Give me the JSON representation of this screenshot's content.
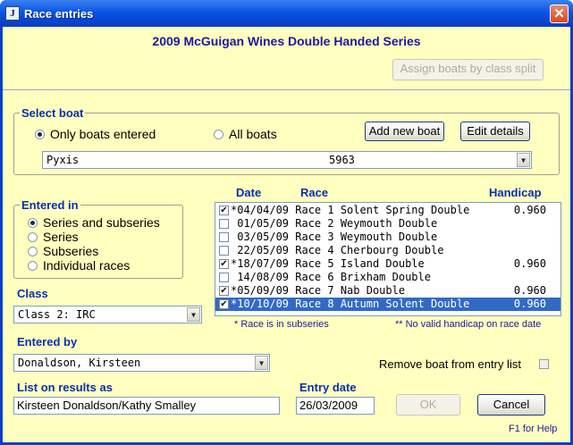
{
  "window": {
    "title": "Race entries",
    "close_glyph": "✕",
    "app_icon_glyph": "J"
  },
  "header": {
    "series_title": "2009 McGuigan Wines Double Handed Series",
    "assign_button": "Assign boats by class split"
  },
  "select_boat": {
    "title": "Select boat",
    "radio_only": "Only boats entered",
    "radio_all": "All boats",
    "selected_radio": "only",
    "add_button": "Add new boat",
    "edit_button": "Edit details",
    "boat_name": "Pyxis",
    "sail_number": "5963"
  },
  "entered_in": {
    "title": "Entered in",
    "options": [
      "Series and subseries",
      "Series",
      "Subseries",
      "Individual races"
    ],
    "selected": 0
  },
  "class": {
    "label": "Class",
    "value": "Class 2: IRC"
  },
  "entered_by": {
    "label": "Entered by",
    "value": "Donaldson, Kirsteen"
  },
  "list_on_results": {
    "label": "List on results as",
    "value": "Kirsteen Donaldson/Kathy Smalley"
  },
  "entry_date": {
    "label": "Entry date",
    "value": "26/03/2009"
  },
  "races": {
    "col_date": "Date",
    "col_race": "Race",
    "col_handicap": "Handicap",
    "rows": [
      {
        "checked": true,
        "text": "*04/04/09 Race 1 Solent Spring Double",
        "handicap": "0.960",
        "selected": false
      },
      {
        "checked": false,
        "text": " 01/05/09 Race 2 Weymouth Double",
        "handicap": "",
        "selected": false
      },
      {
        "checked": false,
        "text": " 03/05/09 Race 3 Weymouth Double",
        "handicap": "",
        "selected": false
      },
      {
        "checked": false,
        "text": " 22/05/09 Race 4 Cherbourg Double",
        "handicap": "",
        "selected": false
      },
      {
        "checked": true,
        "text": "*18/07/09 Race 5 Island Double",
        "handicap": "0.960",
        "selected": false
      },
      {
        "checked": false,
        "text": " 14/08/09 Race 6 Brixham Double",
        "handicap": "",
        "selected": false
      },
      {
        "checked": true,
        "text": "*05/09/09 Race 7 Nab Double",
        "handicap": "0.960",
        "selected": false
      },
      {
        "checked": true,
        "text": "*10/10/09 Race 8 Autumn Solent Double",
        "handicap": "0.960",
        "selected": true
      }
    ],
    "note_subseries": "* Race is in subseries",
    "note_handicap": "** No valid handicap on race date"
  },
  "remove_boat_label": "Remove boat from entry list",
  "ok_button": "OK",
  "cancel_button": "Cancel",
  "help_text": "F1 for Help",
  "check_glyph": "✔"
}
